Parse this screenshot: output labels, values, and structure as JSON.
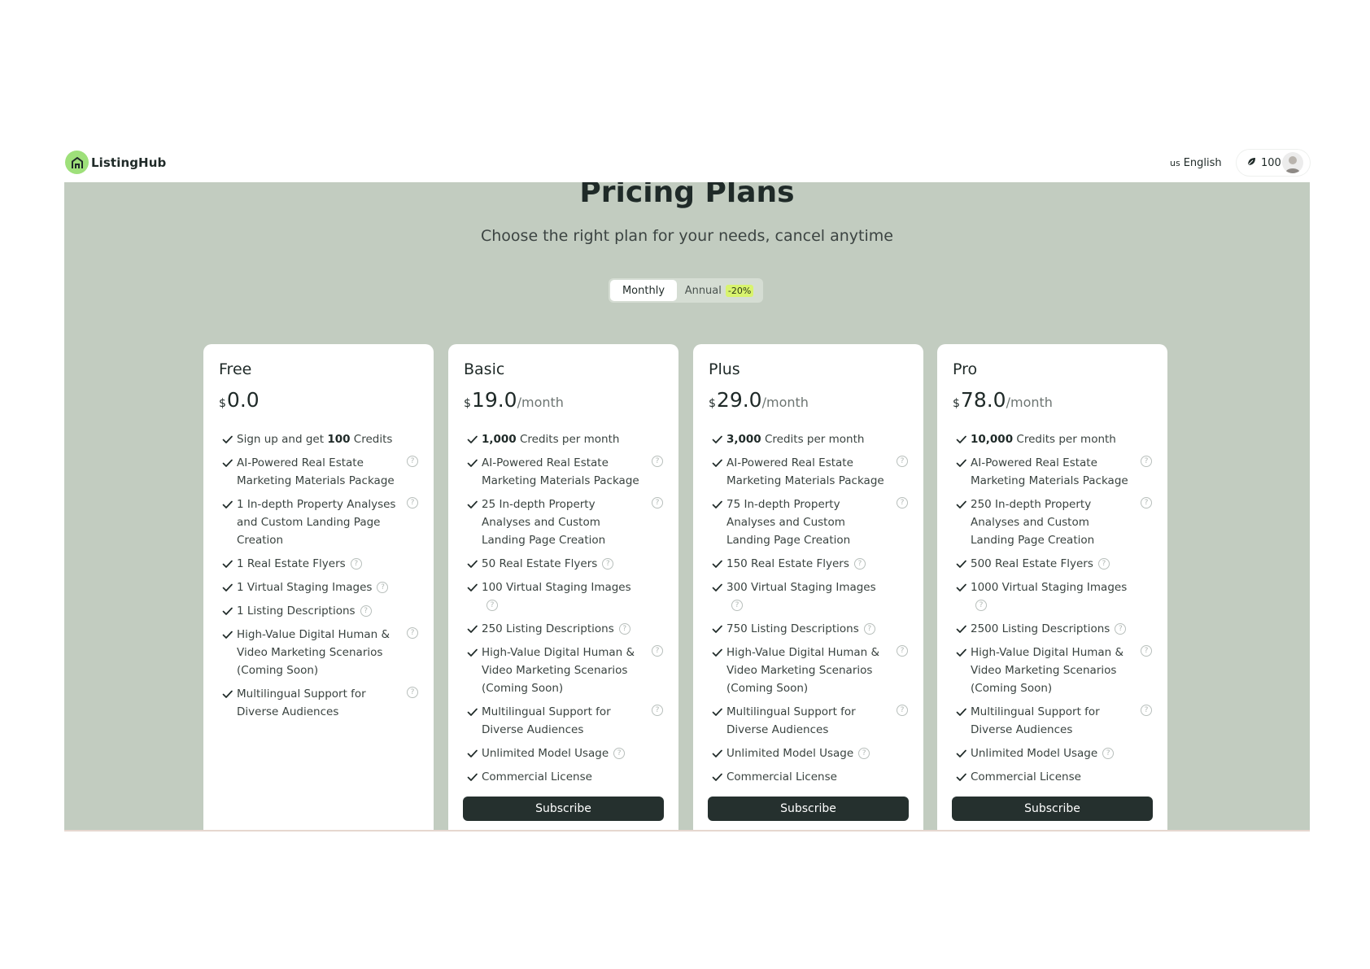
{
  "header": {
    "brand": "ListingHub",
    "language_flag": "us",
    "language": "English",
    "credits": "100"
  },
  "hero": {
    "title": "Pricing Plans",
    "subtitle": "Choose the right plan for your needs, cancel anytime"
  },
  "billing_toggle": {
    "monthly": "Monthly",
    "annual": "Annual",
    "annual_discount": "-20%",
    "selected": "Monthly"
  },
  "plans": [
    {
      "name": "Free",
      "currency": "$",
      "price": "0.0",
      "period": "",
      "features": [
        {
          "bold": "",
          "pre": "Sign up and get ",
          "bold_mid": "100",
          "text": " Credits",
          "help": "none"
        },
        {
          "pre": "",
          "bold_mid": "",
          "text": "AI-Powered Real Estate Marketing Materials Package",
          "help": "right"
        },
        {
          "pre": "",
          "bold_mid": "",
          "text": "1 In-depth Property Analyses and Custom Landing Page Creation",
          "help": "right"
        },
        {
          "pre": "",
          "bold_mid": "",
          "text": "1 Real Estate Flyers",
          "help": "inline"
        },
        {
          "pre": "",
          "bold_mid": "",
          "text": "1 Virtual Staging Images",
          "help": "inline"
        },
        {
          "pre": "",
          "bold_mid": "",
          "text": "1 Listing Descriptions",
          "help": "inline"
        },
        {
          "pre": "",
          "bold_mid": "",
          "text": "High-Value Digital Human & Video Marketing Scenarios (Coming Soon)",
          "help": "right"
        },
        {
          "pre": "",
          "bold_mid": "",
          "text": "Multilingual Support for Diverse Audiences",
          "help": "right"
        }
      ],
      "subscribe": ""
    },
    {
      "name": "Basic",
      "currency": "$",
      "price": "19.0",
      "period": "/month",
      "features": [
        {
          "pre": "",
          "bold_mid": "1,000",
          "text": " Credits per month",
          "help": "none"
        },
        {
          "pre": "",
          "bold_mid": "",
          "text": "AI-Powered Real Estate Marketing Materials Package",
          "help": "right"
        },
        {
          "pre": "",
          "bold_mid": "",
          "text": "25 In-depth Property Analyses and Custom Landing Page Creation",
          "help": "right"
        },
        {
          "pre": "",
          "bold_mid": "",
          "text": "50 Real Estate Flyers",
          "help": "inline"
        },
        {
          "pre": "",
          "bold_mid": "",
          "text": "100 Virtual Staging Images",
          "help": "inline"
        },
        {
          "pre": "",
          "bold_mid": "",
          "text": "250 Listing Descriptions",
          "help": "inline"
        },
        {
          "pre": "",
          "bold_mid": "",
          "text": "High-Value Digital Human & Video Marketing Scenarios (Coming Soon)",
          "help": "right"
        },
        {
          "pre": "",
          "bold_mid": "",
          "text": "Multilingual Support for Diverse Audiences",
          "help": "right"
        },
        {
          "pre": "",
          "bold_mid": "",
          "text": "Unlimited Model Usage",
          "help": "inline"
        },
        {
          "pre": "",
          "bold_mid": "",
          "text": "Commercial License",
          "help": "none"
        }
      ],
      "subscribe": "Subscribe"
    },
    {
      "name": "Plus",
      "currency": "$",
      "price": "29.0",
      "period": "/month",
      "features": [
        {
          "pre": "",
          "bold_mid": "3,000",
          "text": " Credits per month",
          "help": "none"
        },
        {
          "pre": "",
          "bold_mid": "",
          "text": "AI-Powered Real Estate Marketing Materials Package",
          "help": "right"
        },
        {
          "pre": "",
          "bold_mid": "",
          "text": "75 In-depth Property Analyses and Custom Landing Page Creation",
          "help": "right"
        },
        {
          "pre": "",
          "bold_mid": "",
          "text": "150 Real Estate Flyers",
          "help": "inline"
        },
        {
          "pre": "",
          "bold_mid": "",
          "text": "300 Virtual Staging Images",
          "help": "inline"
        },
        {
          "pre": "",
          "bold_mid": "",
          "text": "750 Listing Descriptions",
          "help": "inline"
        },
        {
          "pre": "",
          "bold_mid": "",
          "text": "High-Value Digital Human & Video Marketing Scenarios (Coming Soon)",
          "help": "right"
        },
        {
          "pre": "",
          "bold_mid": "",
          "text": "Multilingual Support for Diverse Audiences",
          "help": "right"
        },
        {
          "pre": "",
          "bold_mid": "",
          "text": "Unlimited Model Usage",
          "help": "inline"
        },
        {
          "pre": "",
          "bold_mid": "",
          "text": "Commercial License",
          "help": "none"
        }
      ],
      "subscribe": "Subscribe"
    },
    {
      "name": "Pro",
      "currency": "$",
      "price": "78.0",
      "period": "/month",
      "features": [
        {
          "pre": "",
          "bold_mid": "10,000",
          "text": " Credits per month",
          "help": "none"
        },
        {
          "pre": "",
          "bold_mid": "",
          "text": "AI-Powered Real Estate Marketing Materials Package",
          "help": "right"
        },
        {
          "pre": "",
          "bold_mid": "",
          "text": "250 In-depth Property Analyses and Custom Landing Page Creation",
          "help": "right"
        },
        {
          "pre": "",
          "bold_mid": "",
          "text": "500 Real Estate Flyers",
          "help": "inline"
        },
        {
          "pre": "",
          "bold_mid": "",
          "text": "1000 Virtual Staging Images",
          "help": "inline"
        },
        {
          "pre": "",
          "bold_mid": "",
          "text": "2500 Listing Descriptions",
          "help": "inline"
        },
        {
          "pre": "",
          "bold_mid": "",
          "text": "High-Value Digital Human & Video Marketing Scenarios (Coming Soon)",
          "help": "right"
        },
        {
          "pre": "",
          "bold_mid": "",
          "text": "Multilingual Support for Diverse Audiences",
          "help": "right"
        },
        {
          "pre": "",
          "bold_mid": "",
          "text": "Unlimited Model Usage",
          "help": "inline"
        },
        {
          "pre": "",
          "bold_mid": "",
          "text": "Commercial License",
          "help": "none"
        }
      ],
      "subscribe": "Subscribe"
    }
  ],
  "icons": {
    "logo": "house-icon",
    "credits": "leaf-icon",
    "check": "check-icon",
    "help": "question-circle-icon",
    "avatar": "user-avatar"
  },
  "colors": {
    "stage_bg": "#c2ccc0",
    "logo_green": "#9ee07a",
    "button_dark": "#25302e",
    "discount_badge": "#d8f36e"
  }
}
